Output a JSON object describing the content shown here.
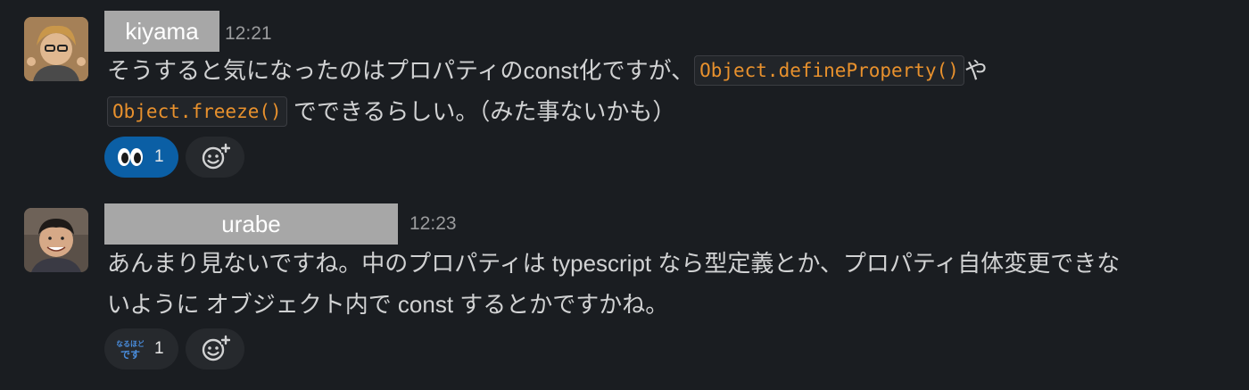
{
  "messages": [
    {
      "author": "kiyama",
      "time": "12:21",
      "line1_text_a": "そうすると気になったのはプロパティのconst化ですが、",
      "line1_code": "Object.defineProperty()",
      "line1_text_b": "や",
      "line2_code": "Object.freeze()",
      "line2_text": "でできるらしい。（みた事ないかも）",
      "reaction": {
        "emoji": "eyes-emoji",
        "count": "1",
        "active": true
      },
      "add_reaction_icon": "add-reaction-icon"
    },
    {
      "author": "urabe",
      "time": "12:23",
      "line1_text": "あんまり見ないですね。中のプロパティは typescript なら型定義とか、プロパティ自体変更できな",
      "line2_text": "いように オブジェクト内で const するとかですかね。",
      "reaction": {
        "emoji": "naruhodo-desu-emoji",
        "emoji_text": "なるほどです",
        "count": "1",
        "active": false
      },
      "add_reaction_icon": "add-reaction-icon"
    }
  ],
  "colors": {
    "background": "#1a1d21",
    "text": "#d1d2d3",
    "code": "#e8912d",
    "reaction_active": "#0b5fa5",
    "reaction_inactive": "#26292d"
  }
}
